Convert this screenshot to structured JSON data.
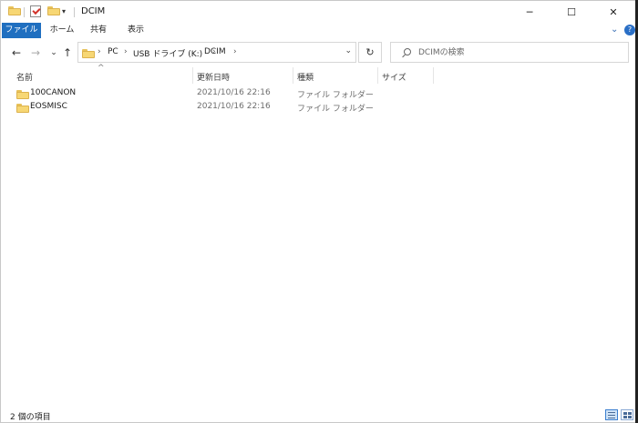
{
  "titlebar": {
    "title": "DCIM",
    "dropdown_glyph": "▾",
    "minimize_glyph": "─",
    "maximize_glyph": "☐",
    "close_glyph": "✕"
  },
  "ribbon": {
    "tabs": [
      {
        "label": "ファイル"
      },
      {
        "label": "ホーム"
      },
      {
        "label": "共有"
      },
      {
        "label": "表示"
      }
    ],
    "expand_glyph": "⌄",
    "help_glyph": "?"
  },
  "nav": {
    "back_glyph": "←",
    "forward_glyph": "→",
    "recent_glyph": "⌄",
    "up_glyph": "↑",
    "breadcrumb": [
      "PC",
      "USB ドライブ (K:)",
      "DCIM"
    ],
    "sep_glyph": "›",
    "refresh_glyph": "↻",
    "search_placeholder": "DCIMの検索"
  },
  "columns": {
    "sort_glyph": "^",
    "name": "名前",
    "date": "更新日時",
    "type": "種類",
    "size": "サイズ"
  },
  "files": [
    {
      "name": "100CANON",
      "date": "2021/10/16 22:16",
      "type": "ファイル フォルダー"
    },
    {
      "name": "EOSMISC",
      "date": "2021/10/16 22:16",
      "type": "ファイル フォルダー"
    }
  ],
  "status": {
    "item_count": "2 個の項目"
  },
  "colors": {
    "file_tab": "#1f6fc0",
    "folder": "#f7d774",
    "accent": "#3b7fd0"
  }
}
